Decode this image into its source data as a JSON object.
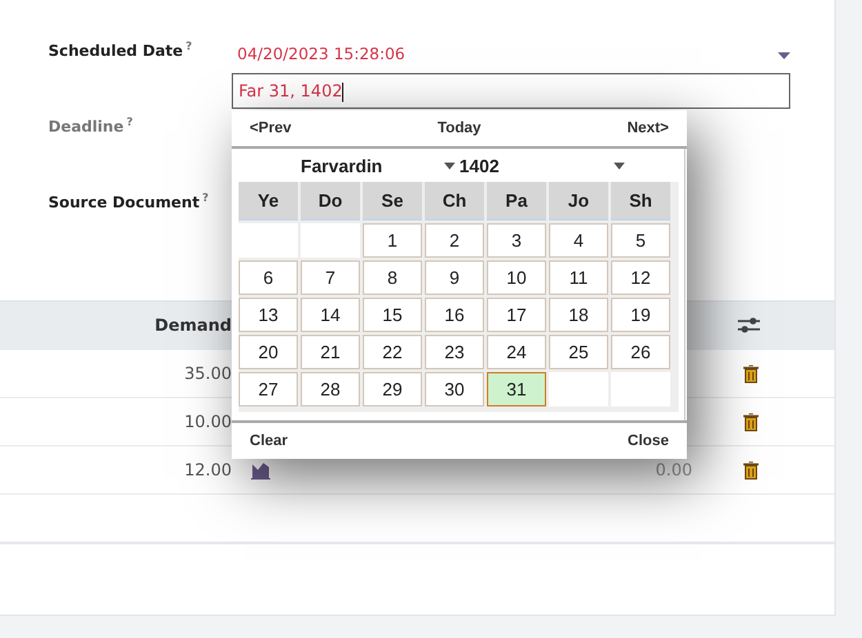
{
  "form": {
    "fields": [
      {
        "label": "Scheduled Date",
        "hint": "?",
        "value": "04/20/2023 15:28:06",
        "kind": "date"
      },
      {
        "label": "Deadline",
        "hint": "?",
        "kind": "muted"
      },
      {
        "label": "Source Document",
        "hint": "?",
        "kind": "plain"
      }
    ]
  },
  "date_input": {
    "value": "Far 31, 1402"
  },
  "datepicker": {
    "prev": "<Prev",
    "today": "Today",
    "next": "Next>",
    "month": "Farvardin",
    "year": "1402",
    "weekdays": [
      "Ye",
      "Do",
      "Se",
      "Ch",
      "Pa",
      "Jo",
      "Sh"
    ],
    "weeks": [
      [
        {
          "kind": "blank"
        },
        {
          "kind": "blank"
        },
        {
          "kind": "day",
          "day": "1",
          "selected": false
        },
        {
          "kind": "day",
          "day": "2",
          "selected": false
        },
        {
          "kind": "day",
          "day": "3",
          "selected": false
        },
        {
          "kind": "day",
          "day": "4",
          "selected": false
        },
        {
          "kind": "day",
          "day": "5",
          "selected": false
        }
      ],
      [
        {
          "kind": "day",
          "day": "6",
          "selected": false
        },
        {
          "kind": "day",
          "day": "7",
          "selected": false
        },
        {
          "kind": "day",
          "day": "8",
          "selected": false
        },
        {
          "kind": "day",
          "day": "9",
          "selected": false
        },
        {
          "kind": "day",
          "day": "10",
          "selected": false
        },
        {
          "kind": "day",
          "day": "11",
          "selected": false
        },
        {
          "kind": "day",
          "day": "12",
          "selected": false
        }
      ],
      [
        {
          "kind": "day",
          "day": "13",
          "selected": false
        },
        {
          "kind": "day",
          "day": "14",
          "selected": false
        },
        {
          "kind": "day",
          "day": "15",
          "selected": false
        },
        {
          "kind": "day",
          "day": "16",
          "selected": false
        },
        {
          "kind": "day",
          "day": "17",
          "selected": false
        },
        {
          "kind": "day",
          "day": "18",
          "selected": false
        },
        {
          "kind": "day",
          "day": "19",
          "selected": false
        }
      ],
      [
        {
          "kind": "day",
          "day": "20",
          "selected": false
        },
        {
          "kind": "day",
          "day": "21",
          "selected": false
        },
        {
          "kind": "day",
          "day": "22",
          "selected": false
        },
        {
          "kind": "day",
          "day": "23",
          "selected": false
        },
        {
          "kind": "day",
          "day": "24",
          "selected": false
        },
        {
          "kind": "day",
          "day": "25",
          "selected": false
        },
        {
          "kind": "day",
          "day": "26",
          "selected": false
        }
      ],
      [
        {
          "kind": "day",
          "day": "27",
          "selected": false
        },
        {
          "kind": "day",
          "day": "28",
          "selected": false
        },
        {
          "kind": "day",
          "day": "29",
          "selected": false
        },
        {
          "kind": "day",
          "day": "30",
          "selected": false
        },
        {
          "kind": "day",
          "day": "31",
          "selected": true
        },
        {
          "kind": "blank"
        },
        {
          "kind": "blank"
        }
      ]
    ],
    "clear": "Clear",
    "close": "Close"
  },
  "table": {
    "columns": [
      "Demand"
    ],
    "rows": [
      {
        "demand": "35.00"
      },
      {
        "demand": "10.00"
      },
      {
        "demand": "12.00",
        "column_2": "0.00"
      }
    ]
  }
}
